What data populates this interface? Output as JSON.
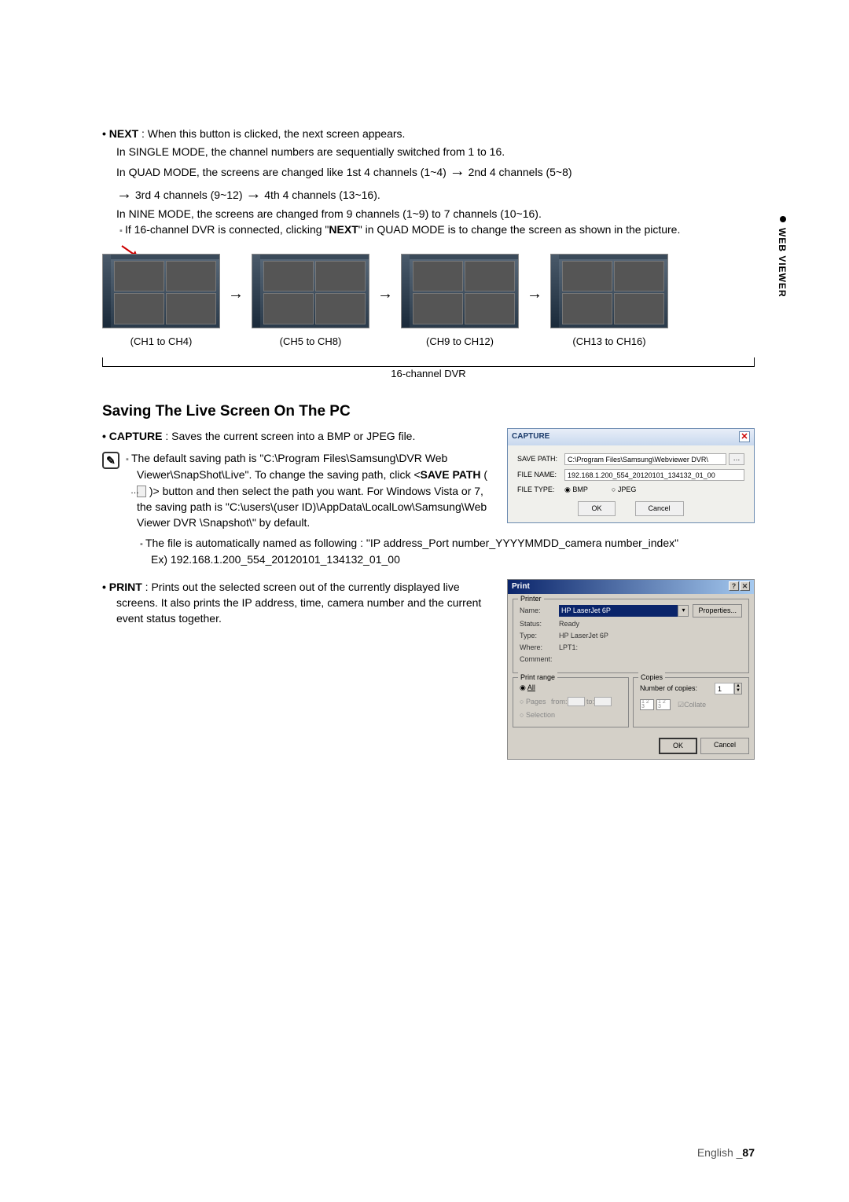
{
  "next_section": {
    "label": "NEXT",
    "desc": " : When this button is clicked, the next screen appears.",
    "line1": "In SINGLE MODE, the channel numbers are sequentially switched from 1 to 16.",
    "line2a": "In QUAD MODE, the screens are changed like 1st 4 channels (1~4) ",
    "line2b": " 2nd 4 channels (5~8)",
    "line3a": " 3rd 4 channels (9~12) ",
    "line3b": " 4th 4 channels (13~16).",
    "line4": "In NINE MODE, the screens are changed from 9 channels (1~9) to 7 channels (10~16).",
    "note_a": "If 16-channel DVR is connected, clicking \"",
    "note_bold": "NEXT",
    "note_b": "\" in QUAD MODE is to change the screen as shown in the picture."
  },
  "quad_labels": {
    "g1": "(CH1 to CH4)",
    "g2": "(CH5 to CH8)",
    "g3": "(CH9 to CH12)",
    "g4": "(CH13 to CH16)",
    "dvr": "16-channel DVR"
  },
  "heading": "Saving The Live Screen On The PC",
  "capture": {
    "label": "CAPTURE",
    "desc": " : Saves the current screen into a BMP or JPEG file.",
    "note1a": "The default saving path is \"C:\\Program Files\\Samsung\\DVR Web Viewer\\SnapShot\\Live\". To change the saving path, click <",
    "note1_bold": "SAVE PATH",
    "note1b": " (",
    "browse_symbol": "…",
    "note1c": " )> button and then select the path you want. For Windows Vista or 7, the saving path is \"C:\\users\\(user ID)\\AppData\\LocalLow\\Samsung\\Web Viewer DVR \\Snapshot\\\" by default.",
    "note2a": "The file is automatically named as following : \"IP address_Port number_YYYYMMDD_camera number_index\"",
    "note2b": "Ex) 192.168.1.200_554_20120101_134132_01_00"
  },
  "capture_dialog": {
    "title": "CAPTURE",
    "save_path_label": "SAVE PATH:",
    "save_path_value": "C:\\Program Files\\Samsung\\Webviewer DVR\\",
    "file_name_label": "FILE NAME:",
    "file_name_value": "192.168.1.200_554_20120101_134132_01_00",
    "file_type_label": "FILE TYPE:",
    "bmp": "BMP",
    "jpeg": "JPEG",
    "ok": "OK",
    "cancel": "Cancel"
  },
  "print": {
    "label": "PRINT",
    "desc": " : Prints out the selected screen out of the currently displayed live screens. It also prints the IP address, time, camera number and the current event status together."
  },
  "print_dialog": {
    "title": "Print",
    "printer_group": "Printer",
    "name_label": "Name:",
    "name_value": "HP LaserJet 6P",
    "properties": "Properties...",
    "status_label": "Status:",
    "status_value": "Ready",
    "type_label": "Type:",
    "type_value": "HP LaserJet 6P",
    "where_label": "Where:",
    "where_value": "LPT1:",
    "comment_label": "Comment:",
    "range_group": "Print range",
    "all": "All",
    "pages": "Pages",
    "from_label": "from:",
    "to_label": "to:",
    "selection": "Selection",
    "copies_group": "Copies",
    "num_copies": "Number of copies:",
    "copies_value": "1",
    "collate": "Collate",
    "ok": "OK",
    "cancel": "Cancel"
  },
  "side_tab": "WEB VIEWER",
  "footer": {
    "lang": "English _",
    "page": "87"
  }
}
